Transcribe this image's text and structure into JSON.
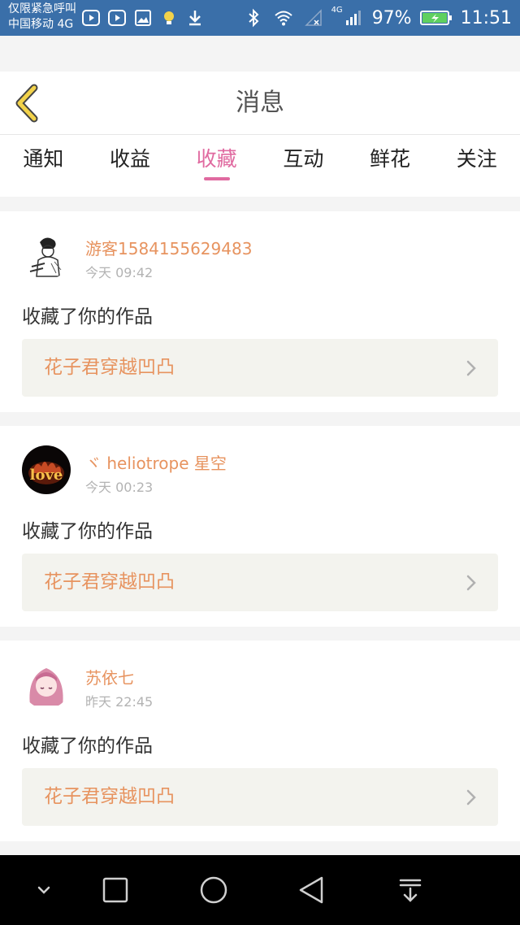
{
  "status_bar": {
    "carrier_line1": "仅限紧急呼叫",
    "carrier_line2": "中国移动 4G",
    "network_type": "4G",
    "battery": "97%",
    "time": "11:51"
  },
  "header": {
    "title": "消息"
  },
  "tabs": [
    {
      "label": "通知"
    },
    {
      "label": "收益"
    },
    {
      "label": "收藏",
      "active": true
    },
    {
      "label": "互动"
    },
    {
      "label": "鲜花"
    },
    {
      "label": "关注"
    }
  ],
  "messages": [
    {
      "username": "游客1584155629483",
      "time": "今天 09:42",
      "action": "收藏了你的作品",
      "work_title": "花子君穿越凹凸"
    },
    {
      "username": "ヾ heliotrope 星空",
      "time": "今天 00:23",
      "action": "收藏了你的作品",
      "work_title": "花子君穿越凹凸"
    },
    {
      "username": "苏依七",
      "time": "昨天 22:45",
      "action": "收藏了你的作品",
      "work_title": "花子君穿越凹凸"
    }
  ],
  "colors": {
    "accent": "#e06aa0",
    "username": "#e7935f",
    "status_bar": "#3a6fa9"
  }
}
